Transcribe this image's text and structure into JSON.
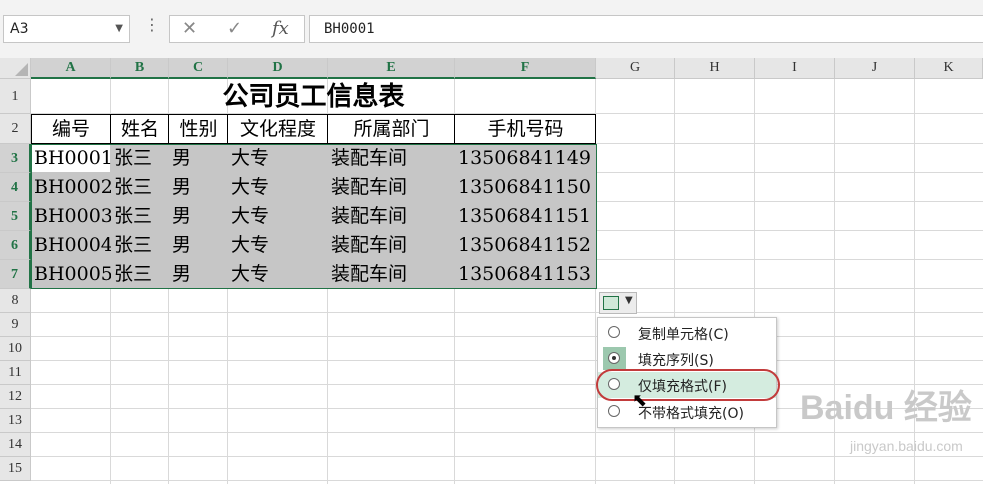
{
  "formula_bar": {
    "name_box": "A3",
    "cancel_icon": "✕",
    "enter_icon": "✓",
    "fx_label": "fx",
    "formula": "BH0001"
  },
  "columns": [
    "A",
    "B",
    "C",
    "D",
    "E",
    "F",
    "G",
    "H",
    "I",
    "J",
    "K"
  ],
  "rows": [
    "1",
    "2",
    "3",
    "4",
    "5",
    "6",
    "7",
    "8",
    "9",
    "10",
    "11",
    "12",
    "13",
    "14",
    "15"
  ],
  "sheet": {
    "title": "公司员工信息表",
    "headers": [
      "编号",
      "姓名",
      "性别",
      "文化程度",
      "所属部门",
      "手机号码"
    ],
    "data": [
      [
        "BH0001",
        "张三",
        "男",
        "大专",
        "装配车间",
        "13506841149"
      ],
      [
        "BH0002",
        "张三",
        "男",
        "大专",
        "装配车间",
        "13506841150"
      ],
      [
        "BH0003",
        "张三",
        "男",
        "大专",
        "装配车间",
        "13506841151"
      ],
      [
        "BH0004",
        "张三",
        "男",
        "大专",
        "装配车间",
        "13506841152"
      ],
      [
        "BH0005",
        "张三",
        "男",
        "大专",
        "装配车间",
        "13506841153"
      ]
    ]
  },
  "autofill_menu": {
    "items": [
      {
        "label": "复制单元格(C)",
        "checked": false
      },
      {
        "label": "填充序列(S)",
        "checked": true
      },
      {
        "label": "仅填充格式(F)",
        "checked": false
      },
      {
        "label": "不带格式填充(O)",
        "checked": false
      }
    ]
  },
  "watermark": {
    "brand": "Baidu 经验",
    "url": "jingyan.baidu.com"
  },
  "colors": {
    "accent": "#217346",
    "selection": "#c6c6c6",
    "highlight": "#c23b3b"
  }
}
